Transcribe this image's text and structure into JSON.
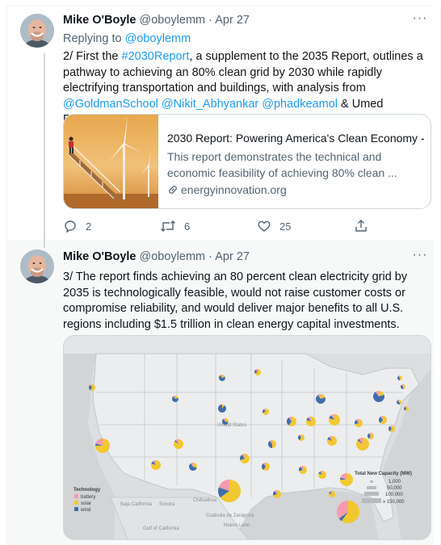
{
  "colors": {
    "link": "#1d9bf0",
    "text": "#0f1419",
    "muted": "#536471",
    "battery": "#f49bb0",
    "solar": "#f2c830",
    "wind": "#3f6fa8"
  },
  "tweets": [
    {
      "author_name": "Mike O'Boyle",
      "handle": "@oboylemm",
      "separator": "·",
      "date": "Apr 27",
      "more_label": "···",
      "replying_prefix": "Replying to",
      "replying_handle": "@oboylemm",
      "text": {
        "p1": "2/ First the ",
        "hashtag": "#2030Report",
        "p2": ", a supplement to the 2035 Report, outlines a pathway to achieving an 80% clean grid by 2030 while rapidly electrifying transportation and buildings, with analysis from ",
        "mention1": "@GoldmanSchool",
        "mention2": "@Nikit_Abhyankar",
        "mention3": "@phadkeamol",
        "p3": " & Umed Paliwal."
      },
      "card": {
        "title": "2030 Report: Powering America's Clean Economy - ...",
        "description": "This report demonstrates the technical and economic feasibility of achieving 80% clean ...",
        "domain": "energyinnovation.org",
        "link_icon": "link-icon"
      },
      "actions": {
        "reply_count": "2",
        "retweet_count": "6",
        "like_count": "25"
      }
    },
    {
      "author_name": "Mike O'Boyle",
      "handle": "@oboylemm",
      "separator": "·",
      "date": "Apr 27",
      "more_label": "···",
      "text": "3/ The report finds achieving an 80 percent clean electricity grid by 2035 is technologically feasible, would not raise customer costs or compromise reliability, and would deliver major benefits to all U.S. regions including $1.5 trillion in clean energy capital investments.",
      "map": {
        "country_label": "United States",
        "legend_title": "Technology",
        "legend_items": [
          "battery",
          "solar",
          "wind"
        ],
        "capacity_title": "Total New Capacity (MW)",
        "capacity_levels": [
          "1,000",
          "50,000",
          "100,000",
          "≥ 150,000"
        ],
        "place_labels": [
          "Baja California",
          "Sonora",
          "Chihuahua",
          "Coahuila de Zaragoza",
          "Nuevo Leon",
          "Gulf of California"
        ]
      }
    }
  ]
}
